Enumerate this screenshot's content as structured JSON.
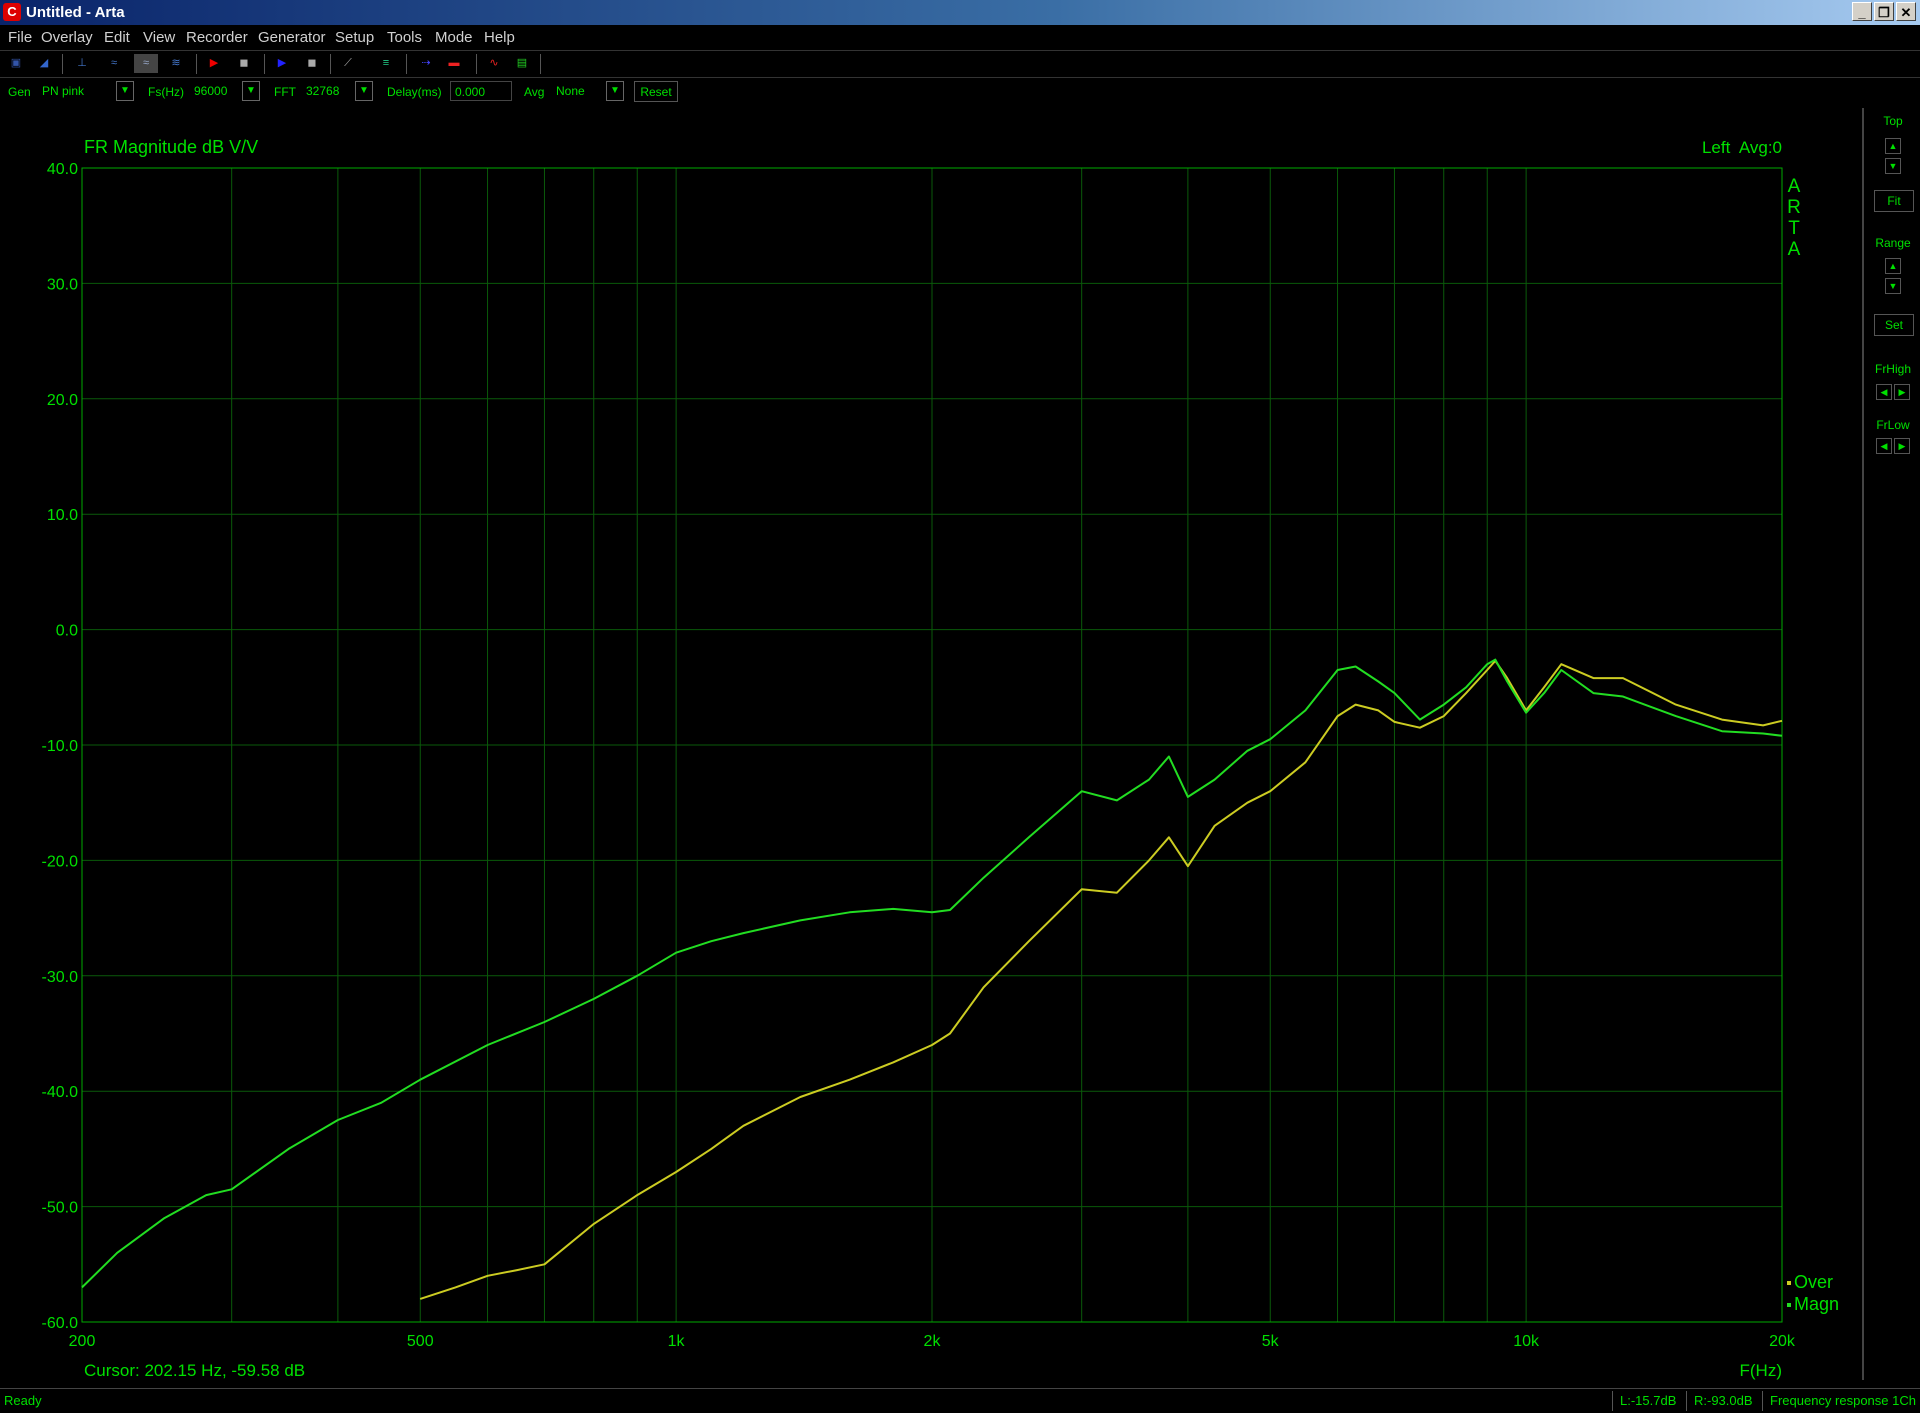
{
  "window": {
    "title": "Untitled - Arta"
  },
  "menu": [
    "File",
    "Overlay",
    "Edit",
    "View",
    "Recorder",
    "Generator",
    "Setup",
    "Tools",
    "Mode",
    "Help"
  ],
  "controls": {
    "gen_label": "Gen",
    "gen_value": "PN pink",
    "fs_label": "Fs(Hz)",
    "fs_value": "96000",
    "fft_label": "FFT",
    "fft_value": "32768",
    "delay_label": "Delay(ms)",
    "delay_value": "0.000",
    "avg_label": "Avg",
    "avg_value": "None",
    "reset_label": "Reset"
  },
  "right_panel": {
    "top": "Top",
    "fit": "Fit",
    "range": "Range",
    "set": "Set",
    "frhigh": "FrHigh",
    "frlow": "FrLow"
  },
  "status": {
    "ready": "Ready",
    "left_level": "L:-15.7dB",
    "right_level": "R:-93.0dB",
    "mode": "Frequency response 1Ch"
  },
  "chart_data": {
    "type": "line",
    "title": "FR Magnitude dB V/V",
    "top_right": "Left  Avg:0",
    "watermark": "ARTA",
    "xlabel": "F(Hz)",
    "xscale": "log",
    "xlim": [
      200,
      20000
    ],
    "ylim": [
      -60,
      40
    ],
    "x_ticks": [
      200,
      500,
      1000,
      2000,
      5000,
      10000,
      20000
    ],
    "x_tick_labels": [
      "200",
      "500",
      "1k",
      "2k",
      "5k",
      "10k",
      "20k"
    ],
    "y_ticks": [
      40,
      30,
      20,
      10,
      0,
      -10,
      -20,
      -30,
      -40,
      -50,
      -60
    ],
    "y_tick_labels": [
      "40.0",
      "30.0",
      "20.0",
      "10.0",
      "0.0",
      "-10.0",
      "-20.0",
      "-30.0",
      "-40.0",
      "-50.0",
      "-60.0"
    ],
    "grid": true,
    "cursor_readout": "Cursor: 202.15 Hz, -59.58 dB",
    "legend": [
      "Over",
      "Magn"
    ],
    "series": [
      {
        "name": "Magn",
        "color": "#22dd22",
        "x": [
          200,
          220,
          250,
          280,
          300,
          350,
          400,
          450,
          500,
          600,
          700,
          800,
          900,
          1000,
          1100,
          1200,
          1400,
          1600,
          1800,
          2000,
          2100,
          2300,
          2600,
          3000,
          3300,
          3600,
          3800,
          4000,
          4300,
          4700,
          5000,
          5500,
          6000,
          6300,
          6700,
          7000,
          7500,
          8000,
          8500,
          9000,
          9200,
          9500,
          10000,
          10500,
          11000,
          12000,
          13000,
          15000,
          17000,
          19000,
          20000
        ],
        "y": [
          -57,
          -54,
          -51,
          -49,
          -48.5,
          -45,
          -42.5,
          -41,
          -39,
          -36,
          -34,
          -32,
          -30,
          -28,
          -27,
          -26.3,
          -25.2,
          -24.5,
          -24.2,
          -24.5,
          -24.3,
          -21.5,
          -18,
          -14,
          -14.8,
          -13,
          -11,
          -14.5,
          -13,
          -10.5,
          -9.5,
          -7,
          -3.5,
          -3.2,
          -4.5,
          -5.5,
          -7.8,
          -6.5,
          -5,
          -3,
          -2.6,
          -4.5,
          -7.2,
          -5.5,
          -3.5,
          -5.5,
          -5.8,
          -7.5,
          -8.8,
          -9,
          -9.2
        ]
      },
      {
        "name": "Over",
        "color": "#cccc22",
        "x": [
          500,
          550,
          600,
          650,
          700,
          800,
          900,
          1000,
          1100,
          1200,
          1400,
          1600,
          1800,
          2000,
          2100,
          2300,
          2600,
          3000,
          3300,
          3600,
          3800,
          4000,
          4300,
          4700,
          5000,
          5500,
          6000,
          6300,
          6700,
          7000,
          7500,
          8000,
          8500,
          9000,
          9200,
          9500,
          10000,
          10500,
          11000,
          12000,
          13000,
          15000,
          17000,
          19000,
          20000
        ],
        "y": [
          -58,
          -57,
          -56,
          -55.5,
          -55,
          -51.5,
          -49,
          -47,
          -45,
          -43,
          -40.5,
          -39,
          -37.5,
          -36,
          -35,
          -31,
          -27,
          -22.5,
          -22.8,
          -20,
          -18,
          -20.5,
          -17,
          -15,
          -14,
          -11.5,
          -7.5,
          -6.5,
          -7,
          -8,
          -8.5,
          -7.5,
          -5.5,
          -3.5,
          -2.7,
          -4.2,
          -7,
          -5,
          -3,
          -4.2,
          -4.2,
          -6.5,
          -7.8,
          -8.3,
          -7.9
        ]
      }
    ]
  }
}
